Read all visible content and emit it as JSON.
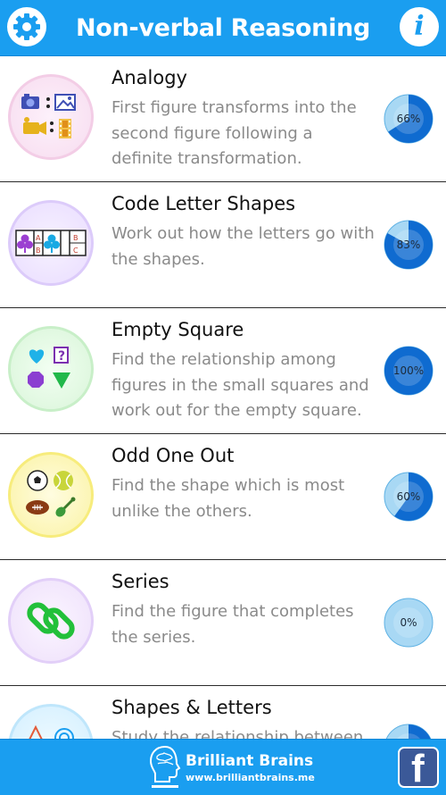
{
  "header": {
    "title": "Non-verbal Reasoning",
    "settings_icon": "gear-icon",
    "info_icon": "info-icon",
    "info_glyph": "i"
  },
  "topics": [
    {
      "title": "Analogy",
      "description": "First figure transforms into the second figure following a definite transformation.",
      "progress": 66,
      "progress_label": "66%",
      "icon": "analogy-icon"
    },
    {
      "title": "Code Letter Shapes",
      "description": "Work out how the letters go with the shapes.",
      "progress": 83,
      "progress_label": "83%",
      "icon": "code-letter-shapes-icon",
      "icon_letters": [
        "A",
        "B",
        "B",
        "C"
      ]
    },
    {
      "title": "Empty Square",
      "description": "Find the relationship among figures in the small squares and work out for the empty square.",
      "progress": 100,
      "progress_label": "100%",
      "icon": "empty-square-icon",
      "icon_glyph": "?"
    },
    {
      "title": "Odd One Out",
      "description": "Find the shape which is most unlike the others.",
      "progress": 60,
      "progress_label": "60%",
      "icon": "odd-one-out-icon"
    },
    {
      "title": "Series",
      "description": "Find the figure that completes the series.",
      "progress": 0,
      "progress_label": "0%",
      "icon": "chain-link-icon"
    },
    {
      "title": "Shapes & Letters",
      "description": "Study the relationship between",
      "progress": 20,
      "progress_label": "",
      "icon": "shapes-letters-icon"
    }
  ],
  "footer": {
    "brand_name": "Brilliant Brains",
    "brand_url": "www.brilliantbrains.me",
    "logo_icon": "brain-head-icon",
    "facebook_icon": "facebook-icon",
    "facebook_glyph": "f"
  },
  "colors": {
    "accent": "#1a9ef0",
    "progress_fill": "#0f6bd0",
    "progress_bg": "#a8d8f4",
    "facebook": "#3b5998"
  }
}
